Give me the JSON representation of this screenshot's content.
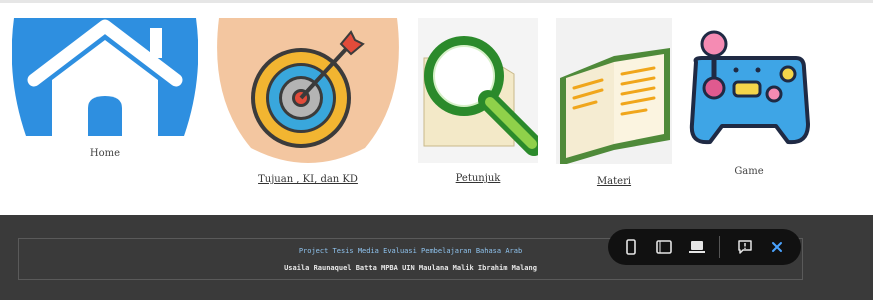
{
  "nav": {
    "items": [
      {
        "label": "Home",
        "icon": "house-icon"
      },
      {
        "label": "Tujuan , KI, dan KD",
        "icon": "target-icon"
      },
      {
        "label": "Petunjuk",
        "icon": "magnifier-icon"
      },
      {
        "label": "Materi",
        "icon": "book-icon"
      },
      {
        "label": "Game",
        "icon": "gamepad-icon"
      }
    ]
  },
  "footer": {
    "line1": "Project Tesis Media Evaluasi Pembelajaran Bahasa Arab",
    "line2": "Usaila Raunaquel Batta MPBA UIN Maulana Malik Ibrahim Malang"
  },
  "toolbar": {
    "buttons": [
      "phone-view-icon",
      "tablet-view-icon",
      "laptop-view-icon",
      "feedback-icon",
      "close-icon"
    ]
  },
  "colors": {
    "home_blue": "#2e8fe0",
    "target_bg": "#f3c6a0",
    "footer_bg": "#3a3a3a",
    "footer_link": "#8fc3ee",
    "toolbar_bg": "#111111",
    "close_accent": "#4aa3ff"
  }
}
